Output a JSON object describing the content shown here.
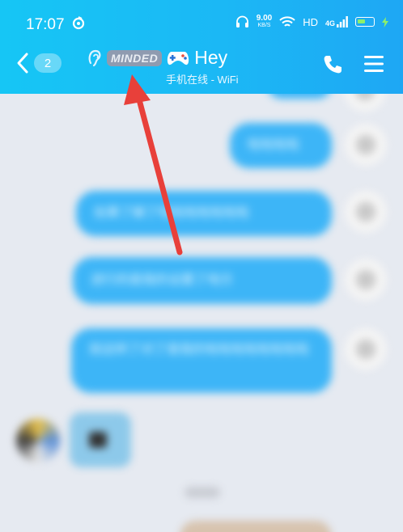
{
  "status_bar": {
    "time": "17:07",
    "speed_value": "9.00",
    "speed_unit": "KB/S",
    "hd": "HD",
    "network": "4G"
  },
  "header": {
    "back_count": "2",
    "badge_text": "MINDED",
    "title": "Hey",
    "subtitle": "手机在线 - WiFi"
  },
  "messages": [
    {
      "sender": "self",
      "text": "啦啦啦啦"
    },
    {
      "sender": "self",
      "text": "如果了解了啦啦啦啦啦啦啦"
    },
    {
      "sender": "self",
      "text": "进行的是我的设置了地方"
    },
    {
      "sender": "self",
      "text": "就这样了对了是我的啦啦啦啦啦啦啦啦"
    },
    {
      "sender": "other",
      "text": ""
    }
  ],
  "colors": {
    "header_start": "#16c6f5",
    "header_end": "#1ea7f4",
    "bubble": "#3db5f7",
    "arrow": "#e8403a",
    "background": "#e6eaf1"
  }
}
